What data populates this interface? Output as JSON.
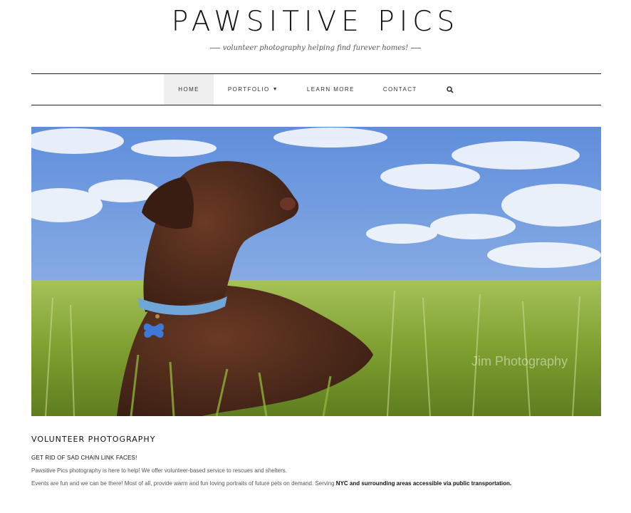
{
  "site": {
    "title": "PAWSITIVE PICS",
    "tagline": "volunteer photography helping find furever homes!"
  },
  "nav": {
    "items": [
      {
        "label": "HOME",
        "active": true
      },
      {
        "label": "PORTFOLIO",
        "has_dropdown": true
      },
      {
        "label": "LEARN MORE"
      },
      {
        "label": "CONTACT"
      }
    ],
    "search_icon": "search-icon"
  },
  "hero": {
    "watermark": "Jim Photography",
    "subject": "chocolate labrador lying in grass under blue sky"
  },
  "content": {
    "heading": "VOLUNTEER PHOTOGRAPHY",
    "line1": "GET RID OF SAD CHAIN LINK FACES!",
    "line2": "Pawsitive Pics photography is here to help!  We offer volunteer-based service to rescues and shelters.",
    "line3_prefix": "Events are fun and we can be there! Most of all, provide warm and fun loving portraits of future pets on demand. Serving ",
    "line3_strong": "NYC and surrounding areas accessible via public transportation."
  },
  "colors": {
    "accent": "#111111",
    "nav_active_bg": "#efefef",
    "sky": "#6f9be0",
    "grass": "#8fb23a",
    "dog": "#4a2a1c"
  }
}
